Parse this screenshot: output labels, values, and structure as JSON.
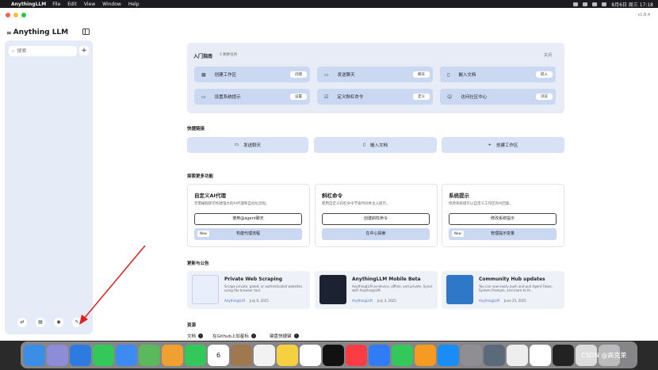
{
  "menubar": {
    "app": "AnythingLLM",
    "items": [
      "File",
      "Edit",
      "View",
      "Window",
      "Help"
    ],
    "clock": "8月6日 周三 17:18"
  },
  "window": {
    "version": "v1.8.4"
  },
  "sidebar": {
    "brand": "Anything LLM",
    "search_placeholder": "搜索",
    "add_label": "+",
    "footer_icons": [
      "community-icon",
      "book-icon",
      "discord-icon",
      "wrench-icon"
    ]
  },
  "guide": {
    "title": "入门指南",
    "count": "5 剩余任务",
    "close": "关闭",
    "tasks": [
      {
        "label": "创建工作区",
        "button": "创建",
        "icon": "workspace-icon"
      },
      {
        "label": "发送聊天",
        "button": "聊天",
        "icon": "chat-icon"
      },
      {
        "label": "嵌入文档",
        "button": "嵌入",
        "icon": "document-icon"
      },
      {
        "label": "设置系统提示",
        "button": "设置",
        "icon": "monitor-icon"
      },
      {
        "label": "定义斜杠命令",
        "button": "定义",
        "icon": "slash-icon"
      },
      {
        "label": "访问社区中心",
        "button": "浏览",
        "icon": "community-icon"
      }
    ]
  },
  "quick": {
    "title": "快捷链接",
    "links": [
      {
        "label": "发送聊天",
        "icon": "chat-icon"
      },
      {
        "label": "嵌入文档",
        "icon": "document-icon"
      },
      {
        "label": "创建工作区",
        "icon": "plus-icon"
      }
    ]
  },
  "explore": {
    "title": "探索更多功能",
    "cards": [
      {
        "title": "自定义AI代理",
        "desc": "无需编程即可构建强大的AI代理和自动化流程。",
        "primary": "使用@agent聊天",
        "secondary": "构建代理流程",
        "badge": "New"
      },
      {
        "title": "斜杠命令",
        "desc": "使用自定义斜杠命令节省时间并注入提示。",
        "primary": "创建斜杠命令",
        "secondary": "在中心探索",
        "badge": ""
      },
      {
        "title": "系统提示",
        "desc": "修改系统提示以自定义工作区的AI回复。",
        "primary": "修改系统提示",
        "secondary": "管理提示变量",
        "badge": "New"
      }
    ]
  },
  "news": {
    "title": "更新与公告",
    "items": [
      {
        "title": "Private Web Scraping",
        "desc": "Scrape private, gated, or authenticated websites using the browser tool.",
        "source": "AnythingLLM",
        "date": "July 6, 2025"
      },
      {
        "title": "AnythingLLM Mobile Beta",
        "desc": "AnythingLLM on-device, offline, and private. Syncs with AnythingLLM.",
        "source": "AnythingLLM",
        "date": "July 3, 2025"
      },
      {
        "title": "Community Hub updates",
        "desc": "You can now easily push and pull Agent Flows, System Prompts, and more to th...",
        "source": "AnythingLLM",
        "date": "June 25, 2025"
      }
    ]
  },
  "resources": {
    "title": "资源",
    "links": [
      "文档",
      "在Github上加星标",
      "键盘快捷键"
    ]
  },
  "dock": {
    "calendar_day": "6",
    "watermark": "CSDN @高克莱"
  },
  "colors": {
    "accent": "#cbd8f1",
    "panel": "#e8ecf7",
    "sidebar": "#e6ebf8",
    "annotation_arrow": "#e02020"
  }
}
